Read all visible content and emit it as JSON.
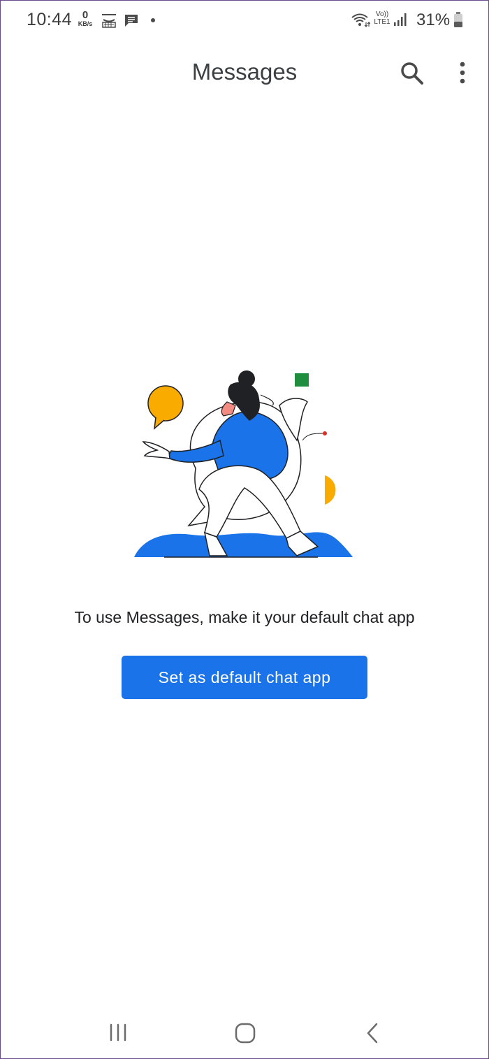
{
  "status_bar": {
    "time": "10:44",
    "net_speed_value": "0",
    "net_speed_unit": "KB/s",
    "network_label_top": "Vo))",
    "network_label_bottom": "LTE1",
    "battery_percent": "31%",
    "icons": [
      "amazon-icon",
      "message-notification-icon",
      "dot-icon",
      "wifi-icon",
      "signal-icon",
      "battery-icon"
    ]
  },
  "toolbar": {
    "title": "Messages",
    "icons": [
      "search-icon",
      "more-vert-icon"
    ]
  },
  "main": {
    "prompt": "To use Messages, make it your default chat app",
    "button_label": "Set as default chat app"
  },
  "nav_bar": {
    "icons": [
      "recents-icon",
      "home-icon",
      "back-icon"
    ]
  },
  "colors": {
    "accent": "#1a73e8",
    "illustration_blue": "#1a73e8",
    "illustration_yellow": "#f9ab00",
    "illustration_green": "#1e8e3e",
    "illustration_red": "#d93025"
  }
}
